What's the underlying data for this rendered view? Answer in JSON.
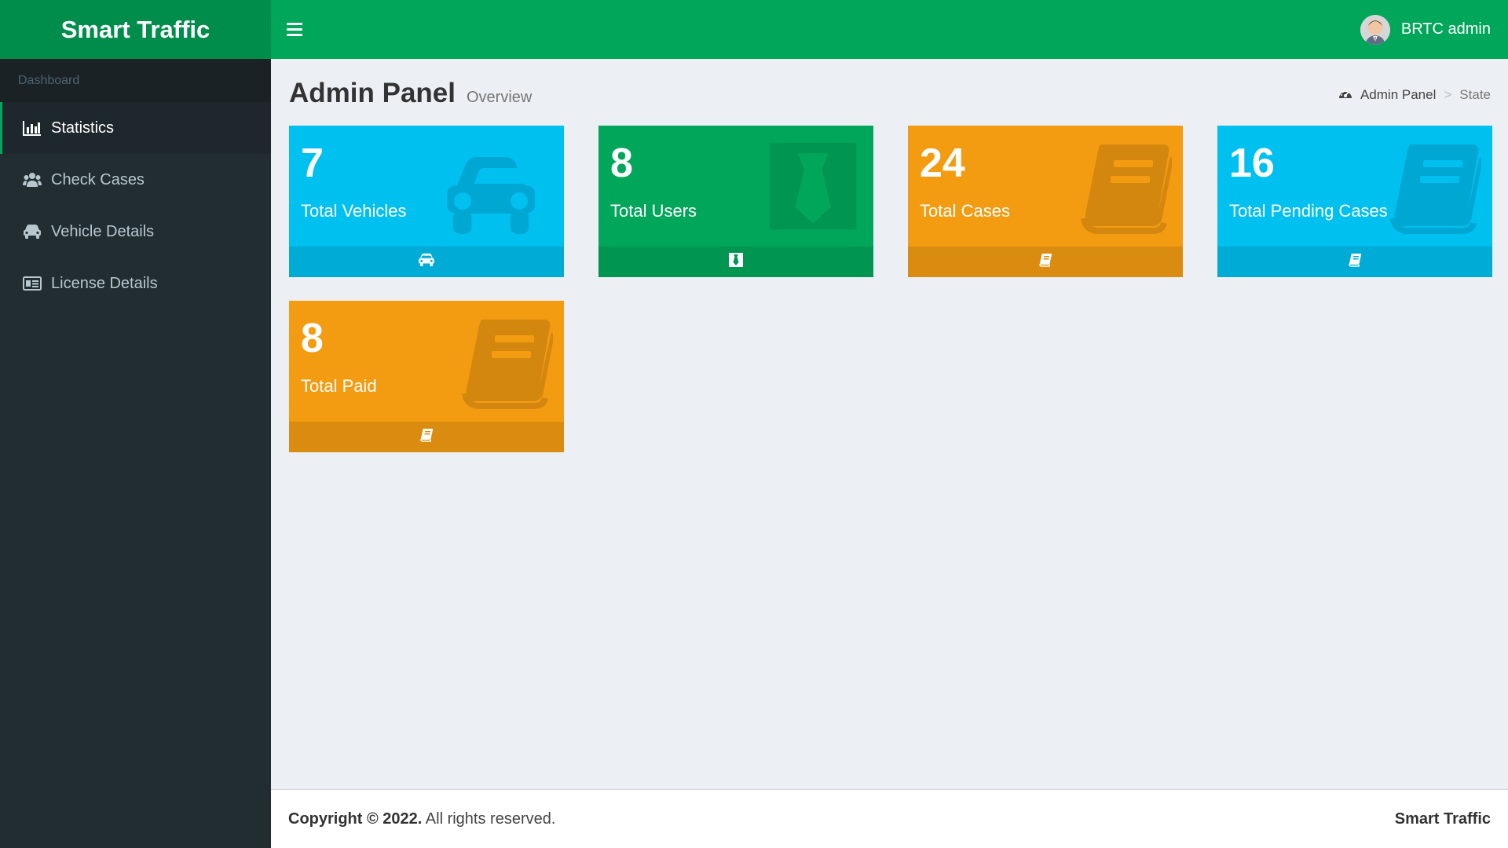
{
  "app": {
    "brand": "Smart Traffic"
  },
  "header": {
    "user_name": "BRTC admin",
    "menu_icon": "bars-icon",
    "avatar_icon": "user-avatar"
  },
  "sidebar": {
    "section": "Dashboard",
    "items": [
      {
        "label": "Statistics",
        "icon": "bar-chart-icon",
        "active": true
      },
      {
        "label": "Check Cases",
        "icon": "users-icon",
        "active": false
      },
      {
        "label": "Vehicle Details",
        "icon": "car-icon",
        "active": false
      },
      {
        "label": "License Details",
        "icon": "id-card-icon",
        "active": false
      }
    ]
  },
  "page": {
    "title": "Admin Panel",
    "subtitle": "Overview",
    "breadcrumb": {
      "icon": "dashboard-icon",
      "home": "Admin Panel",
      "separator": ">",
      "current": "State"
    }
  },
  "stats": [
    {
      "value": "7",
      "label": "Total Vehicles",
      "color": "#00c0ef",
      "icon": "car-icon"
    },
    {
      "value": "8",
      "label": "Total Users",
      "color": "#00a65a",
      "icon": "black-tie-icon"
    },
    {
      "value": "24",
      "label": "Total Cases",
      "color": "#f39c12",
      "icon": "book-icon"
    },
    {
      "value": "16",
      "label": "Total Pending Cases",
      "color": "#00c0ef",
      "icon": "book-icon"
    },
    {
      "value": "8",
      "label": "Total Paid",
      "color": "#f39c12",
      "icon": "book-icon"
    }
  ],
  "footer": {
    "copyright": "Copyright © 2022.",
    "rights": "All rights reserved.",
    "brand": "Smart Traffic"
  },
  "colors": {
    "header": "#00a65a",
    "logo": "#008d4c",
    "sidebar": "#222d32",
    "aqua": "#00c0ef",
    "orange": "#f39c12"
  }
}
